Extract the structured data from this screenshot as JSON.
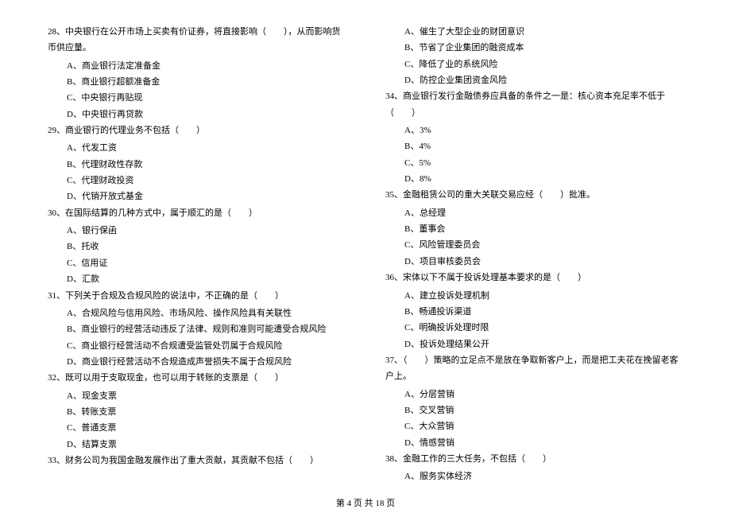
{
  "leftColumn": [
    {
      "text": "28、中央银行在公开市场上买卖有价证券，将直接影响（　　），从而影响货币供应量。",
      "options": [
        "A、商业银行法定准备金",
        "B、商业银行超额准备金",
        "C、中央银行再贴现",
        "D、中央银行再贷款"
      ]
    },
    {
      "text": "29、商业银行的代理业务不包括（　　）",
      "options": [
        "A、代发工资",
        "B、代理财政性存款",
        "C、代理财政投资",
        "D、代销开放式基金"
      ]
    },
    {
      "text": "30、在国际结算的几种方式中，属于顺汇的是（　　）",
      "options": [
        "A、银行保函",
        "B、托收",
        "C、信用证",
        "D、汇款"
      ]
    },
    {
      "text": "31、下列关于合规及合规风险的说法中，不正确的是（　　）",
      "options": [
        "A、合规风险与信用风险、市场风险、操作风险具有关联性",
        "B、商业银行的经营活动违反了法律、规则和准则可能遭受合规风险",
        "C、商业银行经营活动不合规遭受监管处罚属于合规风险",
        "D、商业银行经营活动不合规造成声誉损失不属于合规风险"
      ]
    },
    {
      "text": "32、既可以用于支取现金，也可以用于转账的支票是（　　）",
      "options": [
        "A、现金支票",
        "B、转账支票",
        "C、普通支票",
        "D、结算支票"
      ]
    },
    {
      "text": "33、财务公司为我国金融发展作出了重大贡献，其贡献不包括（　　）",
      "options": []
    }
  ],
  "rightColumn": [
    {
      "options": [
        "A、催生了大型企业的财团意识",
        "B、节省了企业集团的融资成本",
        "C、降低了业的系统风险",
        "D、防控企业集团资金风险"
      ]
    },
    {
      "text": "34、商业银行发行金融债券应具备的条件之一是：核心资本充足率不低于（　　）",
      "options": [
        "A、3%",
        "B、4%",
        "C、5%",
        "D、8%"
      ]
    },
    {
      "text": "35、金融租赁公司的重大关联交易应经（　　）批准。",
      "options": [
        "A、总经理",
        "B、董事会",
        "C、风险管理委员会",
        "D、项目审核委员会"
      ]
    },
    {
      "text": "36、宋体以下不属于投诉处理基本要求的是（　　）",
      "options": [
        "A、建立投诉处理机制",
        "B、畅通投诉渠道",
        "C、明确投诉处理时限",
        "D、投诉处理结果公开"
      ]
    },
    {
      "text": "37、（　　）策略的立足点不是放在争取新客户上，而是把工夫花在挽留老客户上。",
      "options": [
        "A、分层营销",
        "B、交叉营销",
        "C、大众营销",
        "D、情感营销"
      ]
    },
    {
      "text": "38、金融工作的三大任务，不包括（　　）",
      "options": [
        "A、服务实体经济"
      ]
    }
  ],
  "footer": "第 4 页 共 18 页"
}
